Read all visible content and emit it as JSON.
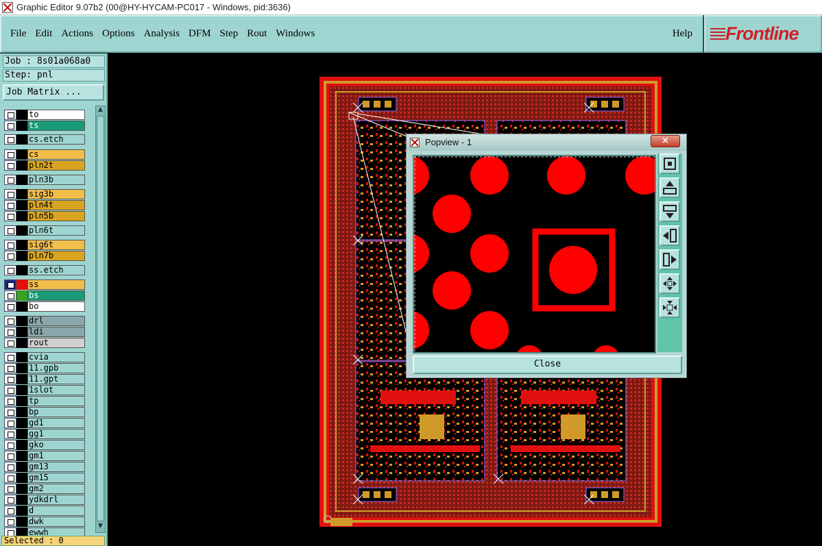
{
  "window": {
    "title": "Graphic Editor 9.07b2 (00@HY-HYCAM-PC017 - Windows, pid:3636)"
  },
  "menu": {
    "items": [
      {
        "label": "File"
      },
      {
        "label": "Edit"
      },
      {
        "label": "Actions"
      },
      {
        "label": "Options"
      },
      {
        "label": "Analysis"
      },
      {
        "label": "DFM"
      },
      {
        "label": "Step"
      },
      {
        "label": "Rout"
      },
      {
        "label": "Windows"
      }
    ],
    "help": "Help"
  },
  "logo": {
    "text": "Frontline",
    "color": "#d0202a"
  },
  "panel": {
    "job": "Job : 8s01a068a0",
    "step": "Step: pnl",
    "job_matrix": "Job Matrix ...",
    "selected": "Selected : 0"
  },
  "layers": [
    {
      "name": "to",
      "color": "#ffffff"
    },
    {
      "name": "ts",
      "color": "#1a9b77"
    },
    {
      "name": "cs.etch",
      "color": "#9fd5d1"
    },
    {
      "name": "cs",
      "color": "#f2be4b"
    },
    {
      "name": "pln2t",
      "color": "#d9a520"
    },
    {
      "name": "pln3b",
      "color": "#9fd5d1"
    },
    {
      "name": "sig3b",
      "color": "#f2be4b"
    },
    {
      "name": "pln4t",
      "color": "#d9a520"
    },
    {
      "name": "pln5b",
      "color": "#d9a520"
    },
    {
      "name": "pln6t",
      "color": "#9fd5d1"
    },
    {
      "name": "sig6t",
      "color": "#f2be4b"
    },
    {
      "name": "pln7b",
      "color": "#d9a520"
    },
    {
      "name": "ss.etch",
      "color": "#9fd5d1"
    },
    {
      "name": "ss",
      "color": "#f2be4b",
      "active": true
    },
    {
      "name": "bs",
      "color": "#1a9b77"
    },
    {
      "name": "bo",
      "color": "#ffffff"
    },
    {
      "name": "drl",
      "color": "#8aa7ab"
    },
    {
      "name": "ldi",
      "color": "#8aa7ab"
    },
    {
      "name": "rout",
      "color": "#d0d0d0"
    },
    {
      "name": "cvia",
      "color": "#9fd5d1"
    },
    {
      "name": "11.gpb",
      "color": "#9fd5d1"
    },
    {
      "name": "11.gpt",
      "color": "#9fd5d1"
    },
    {
      "name": "1slot",
      "color": "#9fd5d1"
    },
    {
      "name": "tp",
      "color": "#9fd5d1"
    },
    {
      "name": "bp",
      "color": "#9fd5d1"
    },
    {
      "name": "gd1",
      "color": "#9fd5d1"
    },
    {
      "name": "gg1",
      "color": "#9fd5d1"
    },
    {
      "name": "gko",
      "color": "#9fd5d1"
    },
    {
      "name": "gm1",
      "color": "#9fd5d1"
    },
    {
      "name": "gm13",
      "color": "#9fd5d1"
    },
    {
      "name": "gm15",
      "color": "#9fd5d1"
    },
    {
      "name": "gm2",
      "color": "#9fd5d1"
    },
    {
      "name": "ydkdrl",
      "color": "#9fd5d1"
    },
    {
      "name": "d",
      "color": "#9fd5d1"
    },
    {
      "name": "dwk",
      "color": "#9fd5d1"
    },
    {
      "name": "ewwh",
      "color": "#9fd5d1"
    }
  ],
  "popview": {
    "title": "Popview - 1",
    "close_label": "Close",
    "close_x": "×",
    "tools": [
      "zoom-fit-icon",
      "pan-up-icon",
      "pan-down-icon",
      "pan-left-icon",
      "pan-right-icon",
      "zoom-in-icon",
      "zoom-out-icon"
    ]
  },
  "colors": {
    "copper": "#ff0000",
    "board_bg": "#7a1a14",
    "frame": "#d09a2a"
  }
}
